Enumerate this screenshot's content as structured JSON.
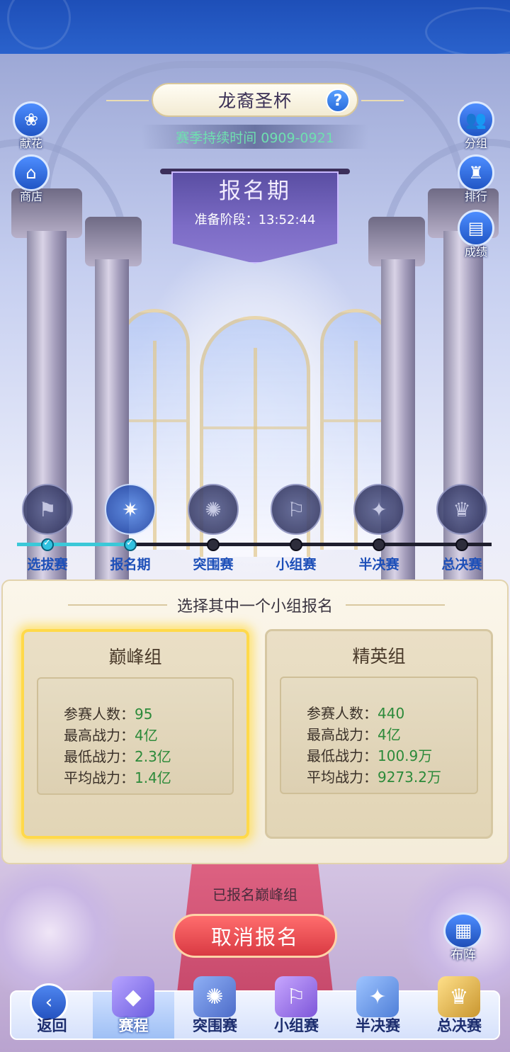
{
  "header": {
    "title": "龙裔圣杯",
    "help_icon": "?",
    "season_text": "赛季持续时间 0909-0921"
  },
  "phase": {
    "title": "报名期",
    "countdown": "准备阶段：13:52:44"
  },
  "left_buttons": [
    {
      "label": "献花",
      "icon": "flower-icon",
      "glyph": "❀"
    },
    {
      "label": "商店",
      "icon": "shop-icon",
      "glyph": "⌂"
    }
  ],
  "right_buttons": [
    {
      "label": "分组",
      "icon": "group-icon",
      "glyph": "👥"
    },
    {
      "label": "排行",
      "icon": "ranking-icon",
      "glyph": "♜"
    },
    {
      "label": "成绩",
      "icon": "results-icon",
      "glyph": "▤"
    }
  ],
  "stages": [
    {
      "label": "选拔赛",
      "icon": "flag-icon",
      "glyph": "⚑",
      "done": true
    },
    {
      "label": "报名期",
      "icon": "book-icon",
      "glyph": "✷",
      "done": true
    },
    {
      "label": "突围赛",
      "icon": "scroll-icon",
      "glyph": "✺",
      "done": false
    },
    {
      "label": "小组赛",
      "icon": "team-flag-icon",
      "glyph": "⚐",
      "done": false
    },
    {
      "label": "半决赛",
      "icon": "shield-icon",
      "glyph": "✦",
      "done": false
    },
    {
      "label": "总决赛",
      "icon": "trophy-icon",
      "glyph": "♛",
      "done": false
    }
  ],
  "panel": {
    "heading": "选择其中一个小组报名",
    "groups": [
      {
        "name": "巅峰组",
        "selected": true,
        "stats": [
          {
            "label": "参赛人数：",
            "value": "95"
          },
          {
            "label": "最高战力：",
            "value": "4亿"
          },
          {
            "label": "最低战力：",
            "value": "2.3亿"
          },
          {
            "label": "平均战力：",
            "value": "1.4亿"
          }
        ]
      },
      {
        "name": "精英组",
        "selected": false,
        "stats": [
          {
            "label": "参赛人数：",
            "value": "440"
          },
          {
            "label": "最高战力：",
            "value": "4亿"
          },
          {
            "label": "最低战力：",
            "value": "100.9万"
          },
          {
            "label": "平均战力：",
            "value": "9273.2万"
          }
        ]
      }
    ]
  },
  "registration_status": "已报名巅峰组",
  "cancel_button": "取消报名",
  "formation_button": "布阵",
  "bottom_nav": [
    {
      "label": "返回",
      "icon": "back-icon",
      "glyph": "‹",
      "active": false
    },
    {
      "label": "赛程",
      "icon": "crystal-icon",
      "glyph": "◆",
      "active": true
    },
    {
      "label": "突围赛",
      "icon": "scroll-icon",
      "glyph": "✺",
      "active": false
    },
    {
      "label": "小组赛",
      "icon": "team-flag-icon",
      "glyph": "⚐",
      "active": false
    },
    {
      "label": "半决赛",
      "icon": "shield-icon",
      "glyph": "✦",
      "active": false
    },
    {
      "label": "总决赛",
      "icon": "trophy-icon",
      "glyph": "♛",
      "active": false
    }
  ],
  "colors": {
    "accent_blue": "#1d4fb8",
    "stat_value_green": "#2c8a3a",
    "cancel_red": "#d93a43",
    "selected_glow": "#ffd94a"
  }
}
